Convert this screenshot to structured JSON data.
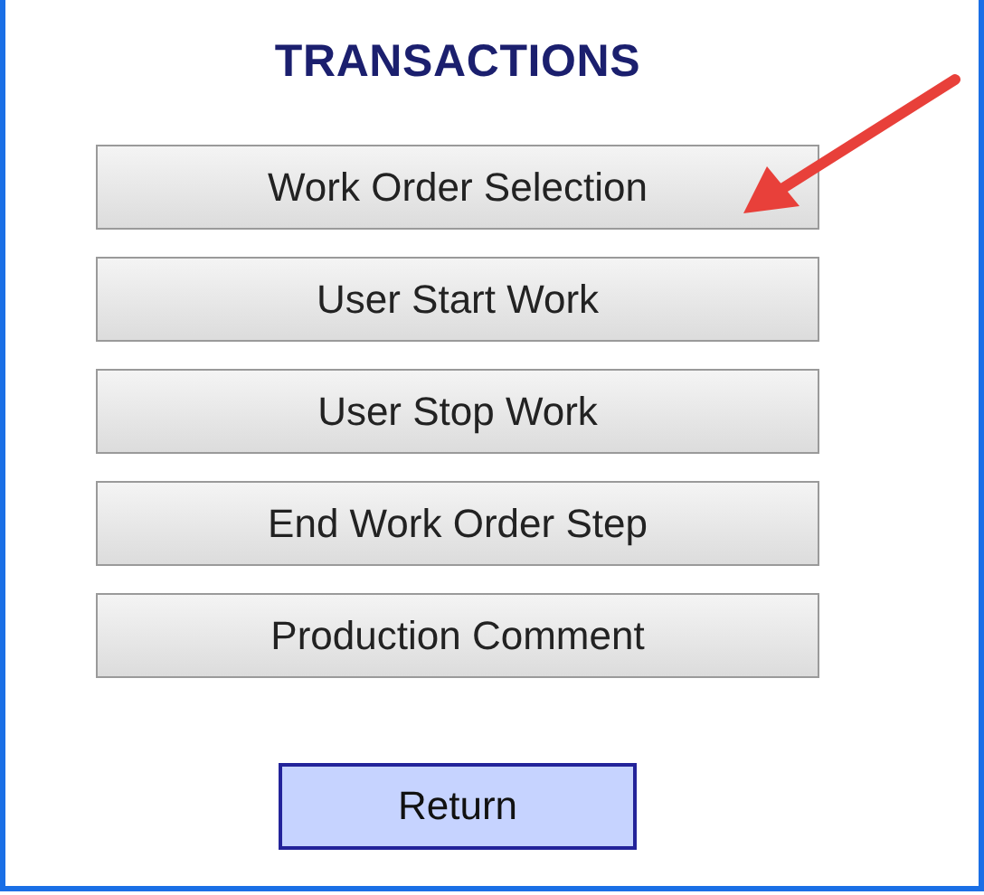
{
  "title": "TRANSACTIONS",
  "buttons": [
    {
      "label": "Work Order Selection"
    },
    {
      "label": "User Start Work"
    },
    {
      "label": "User Stop Work"
    },
    {
      "label": "End Work Order Step"
    },
    {
      "label": "Production Comment"
    }
  ],
  "return_button": {
    "label": "Return"
  }
}
